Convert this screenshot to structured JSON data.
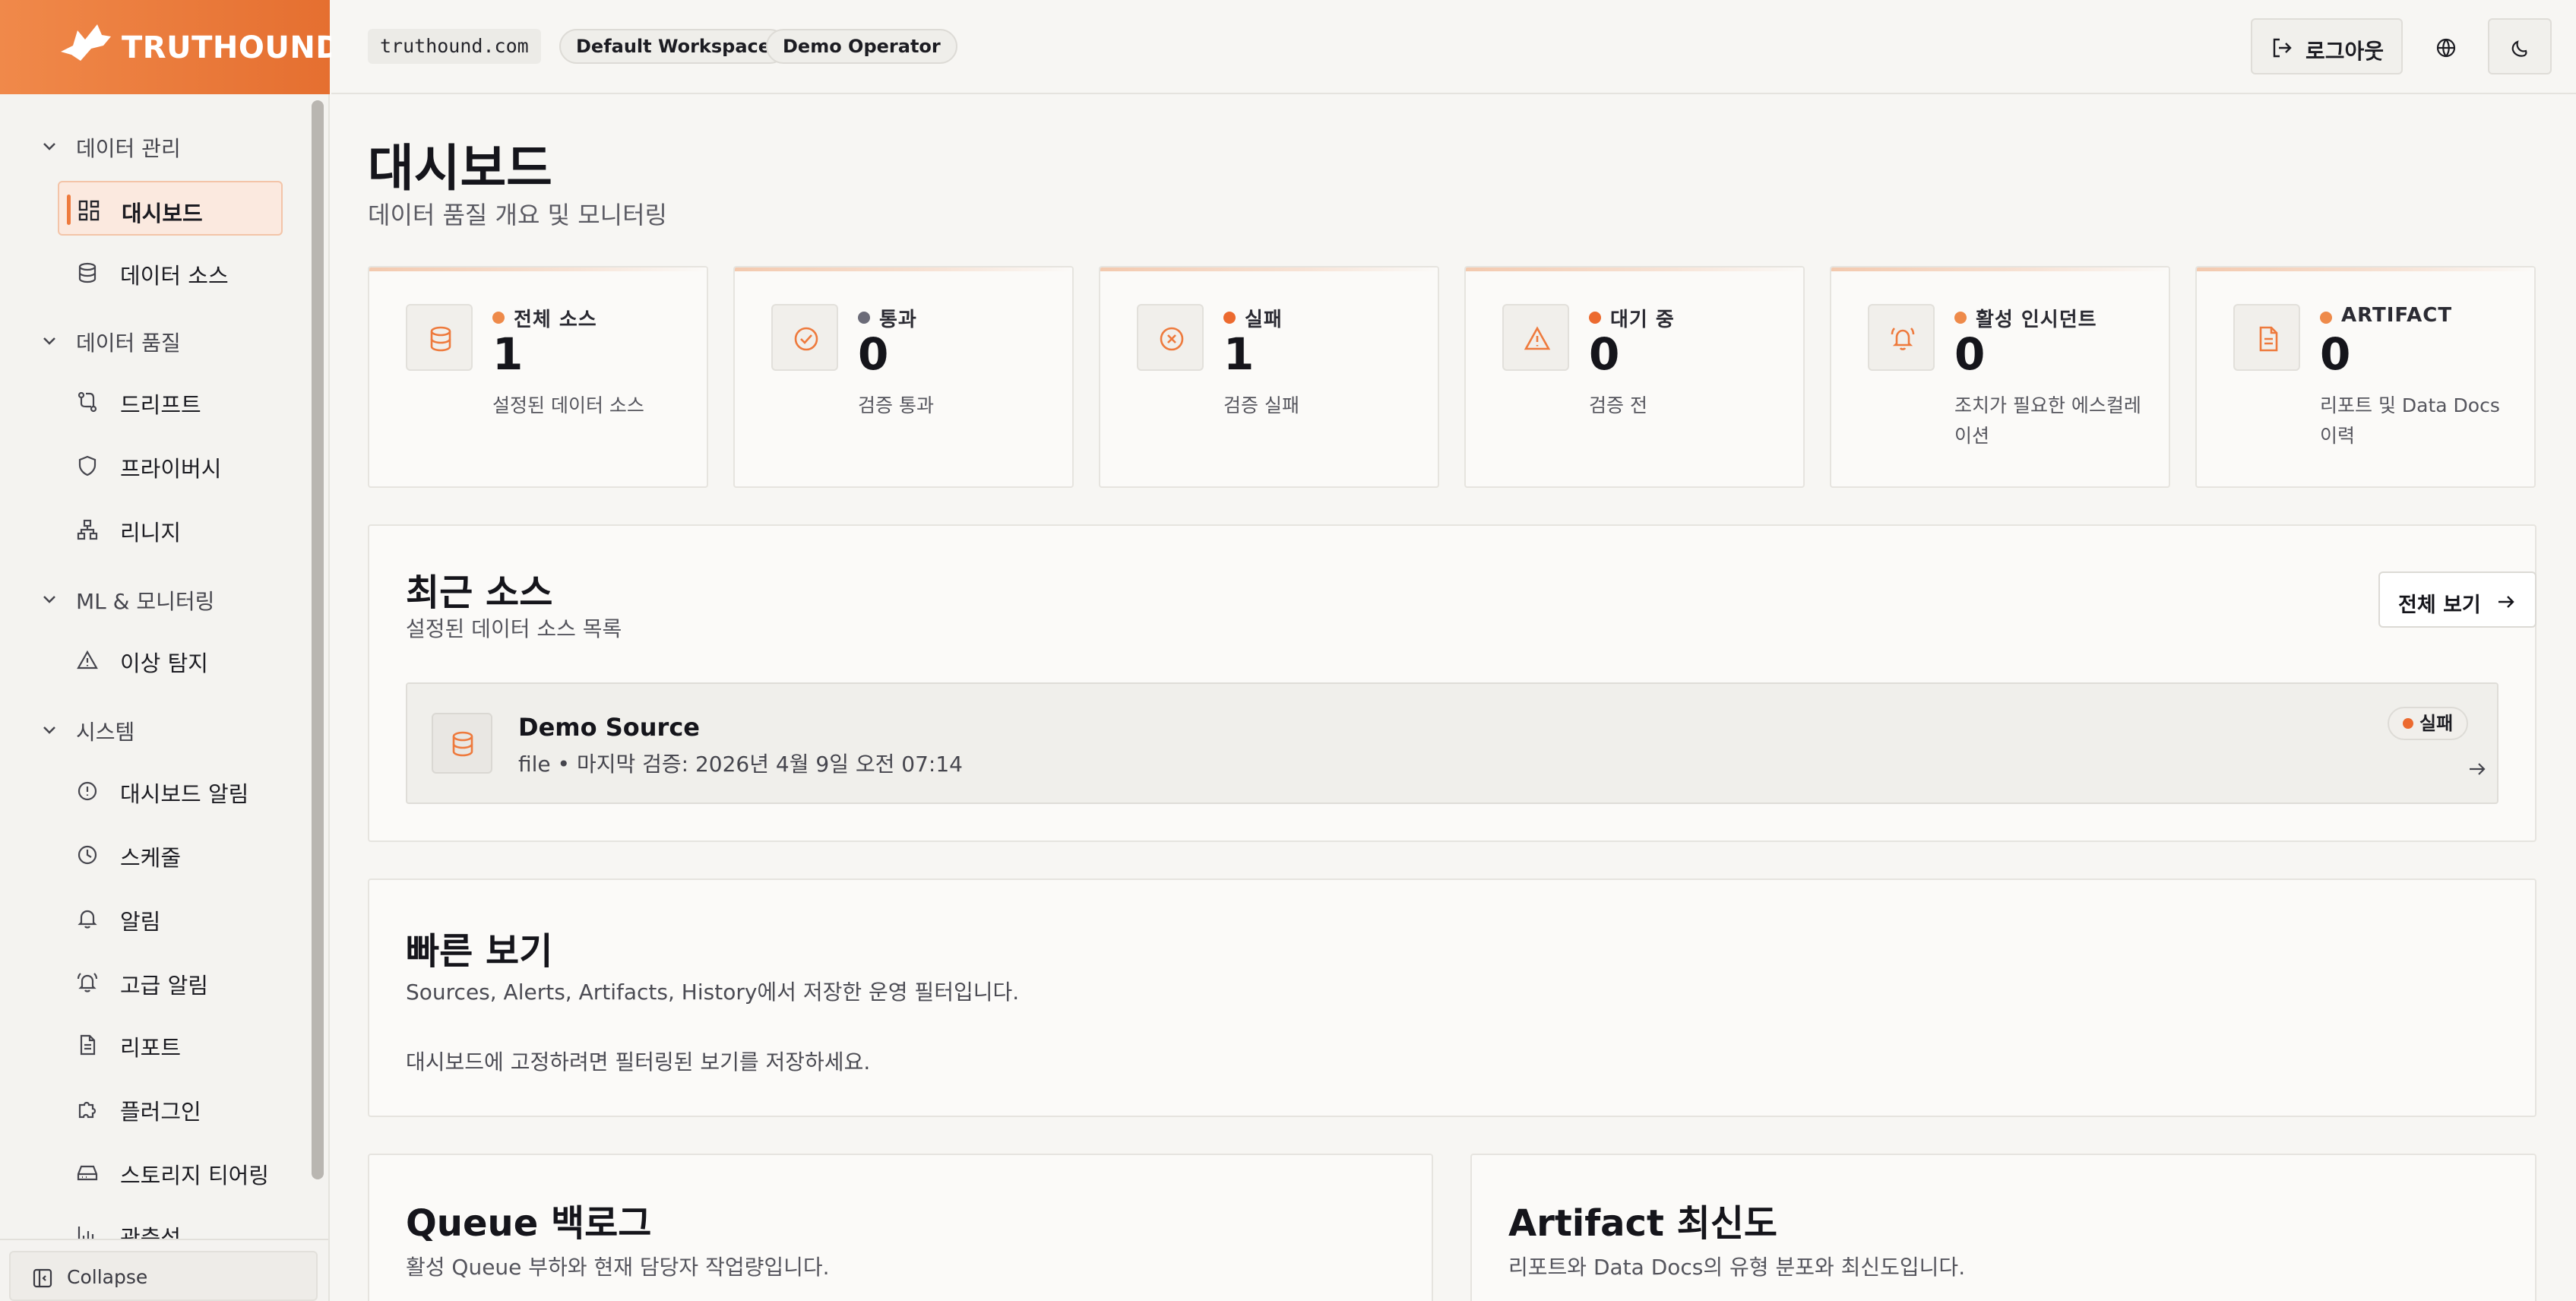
{
  "app": {
    "brand": "TRUTHOUND"
  },
  "header": {
    "domain": "truthound.com",
    "workspace": "Default Workspace",
    "operator": "Demo Operator",
    "logout_label": "로그아웃"
  },
  "sidebar": {
    "groups": [
      {
        "label": "데이터 관리"
      },
      {
        "label": "데이터 품질"
      },
      {
        "label": "ML & 모니터링"
      },
      {
        "label": "시스템"
      }
    ],
    "items": [
      {
        "label": "대시보드",
        "icon": "dashboard-icon",
        "active": true
      },
      {
        "label": "데이터 소스",
        "icon": "database-icon"
      },
      {
        "label": "드리프트",
        "icon": "drift-icon"
      },
      {
        "label": "프라이버시",
        "icon": "shield-icon"
      },
      {
        "label": "리니지",
        "icon": "lineage-icon"
      },
      {
        "label": "이상 탐지",
        "icon": "warning-icon"
      },
      {
        "label": "대시보드 알림",
        "icon": "alert-circle-icon"
      },
      {
        "label": "스케줄",
        "icon": "clock-icon"
      },
      {
        "label": "알림",
        "icon": "bell-icon"
      },
      {
        "label": "고급 알림",
        "icon": "bell-ring-icon"
      },
      {
        "label": "리포트",
        "icon": "file-icon"
      },
      {
        "label": "플러그인",
        "icon": "puzzle-icon"
      },
      {
        "label": "스토리지 티어링",
        "icon": "hard-drive-icon"
      },
      {
        "label": "관측성",
        "icon": "chart-icon"
      }
    ],
    "collapse_label": "Collapse"
  },
  "page": {
    "title": "대시보드",
    "subtitle": "데이터 품질 개요 및 모니터링"
  },
  "stats": [
    {
      "label": "전체 소스",
      "value": "1",
      "desc": "설정된 데이터 소스",
      "dot": "#ee8a4a",
      "icon": "database-icon"
    },
    {
      "label": "통과",
      "value": "0",
      "desc": "검증 통과",
      "dot": "#6b6b78",
      "icon": "check-circle-icon"
    },
    {
      "label": "실패",
      "value": "1",
      "desc": "검증 실패",
      "dot": "#ec6a2f",
      "icon": "x-circle-icon"
    },
    {
      "label": "대기 중",
      "value": "0",
      "desc": "검증 전",
      "dot": "#ec6a2f",
      "icon": "warning-icon"
    },
    {
      "label": "활성 인시던트",
      "value": "0",
      "desc": "조치가 필요한 에스컬레이션",
      "dot": "#ee8a4a",
      "icon": "bell-ring-icon"
    },
    {
      "label": "ARTIFACT",
      "value": "0",
      "desc": "리포트 및 Data Docs 이력",
      "dot": "#ee8a4a",
      "icon": "file-icon"
    }
  ],
  "recent": {
    "title": "최근 소스",
    "subtitle": "설정된 데이터 소스 목록",
    "view_all": "전체 보기",
    "source": {
      "name": "Demo Source",
      "meta": "file • 마지막 검증: 2026년 4월 9일 오전 07:14",
      "status": "실패"
    }
  },
  "quick": {
    "title": "빠른 보기",
    "subtitle": "Sources, Alerts, Artifacts, History에서 저장한 운영 필터입니다.",
    "empty": "대시보드에 고정하려면 필터링된 보기를 저장하세요."
  },
  "queue": {
    "title": "Queue 백로그",
    "subtitle": "활성 Queue 부하와 현재 담당자 작업량입니다."
  },
  "artifact": {
    "title": "Artifact 최신도",
    "subtitle": "리포트와 Data Docs의 유형 분포와 최신도입니다."
  },
  "colors": {
    "accent": "#ee7a3d",
    "brand_gradient_start": "#f0894a",
    "brand_gradient_end": "#e56f30",
    "failed": "#ec6a2f",
    "neutral": "#6b6b78"
  }
}
